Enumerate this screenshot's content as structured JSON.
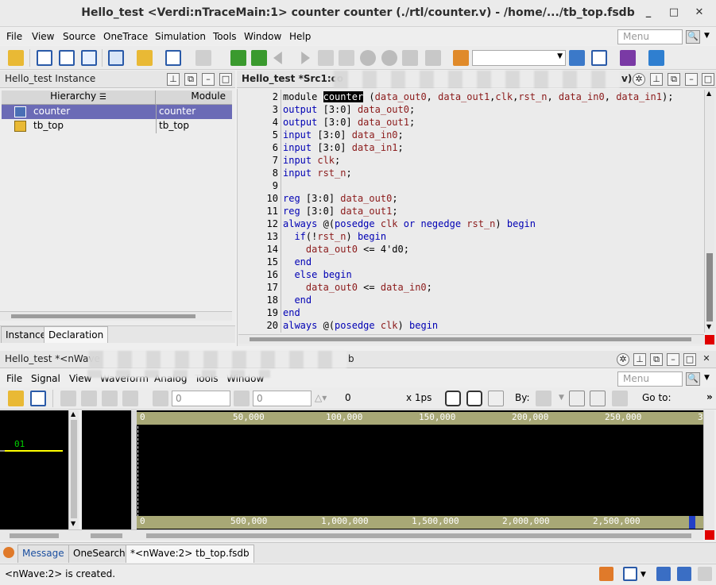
{
  "window": {
    "title": "Hello_test <Verdi:nTraceMain:1> counter counter (./rtl/counter.v) - /home/.../tb_top.fsdb"
  },
  "main_menu": {
    "items": [
      "File",
      "View",
      "Source",
      "OneTrace",
      "Simulation",
      "Tools",
      "Window",
      "Help"
    ],
    "search_placeholder": "Menu"
  },
  "instance_panel": {
    "title": "Hello_test Instance",
    "columns": [
      "Hierarchy",
      "Module"
    ],
    "rows": [
      {
        "hierarchy": "counter",
        "module": "counter"
      },
      {
        "hierarchy": "tb_top",
        "module": "tb_top"
      }
    ],
    "tabs": [
      "Instance",
      "Declaration"
    ]
  },
  "source_panel": {
    "title": "Hello_test *Src1:co",
    "title_tail": "v)",
    "lines": [
      {
        "n": "2",
        "text": "module counter (data_out0, data_out1,clk,rst_n, data_in0, data_in1);"
      },
      {
        "n": "3",
        "text": "output [3:0] data_out0;"
      },
      {
        "n": "4",
        "text": "output [3:0] data_out1;"
      },
      {
        "n": "5",
        "text": "input [3:0] data_in0;"
      },
      {
        "n": "6",
        "text": "input [3:0] data_in1;"
      },
      {
        "n": "7",
        "text": "input clk;"
      },
      {
        "n": "8",
        "text": "input rst_n;"
      },
      {
        "n": "9",
        "text": ""
      },
      {
        "n": "10",
        "text": "reg [3:0] data_out0;"
      },
      {
        "n": "11",
        "text": "reg [3:0] data_out1;"
      },
      {
        "n": "12",
        "text": "always @(posedge clk or negedge rst_n) begin"
      },
      {
        "n": "13",
        "text": "  if(!rst_n) begin"
      },
      {
        "n": "14",
        "text": "    data_out0 <= 4'd0;"
      },
      {
        "n": "15",
        "text": "  end"
      },
      {
        "n": "16",
        "text": "  else begin"
      },
      {
        "n": "17",
        "text": "    data_out0 <= data_in0;"
      },
      {
        "n": "18",
        "text": "  end"
      },
      {
        "n": "19",
        "text": "end"
      },
      {
        "n": "20",
        "text": "always @(posedge clk) begin"
      }
    ]
  },
  "nwave_panel": {
    "title": "Hello_test *<nWave",
    "title_tail": "b",
    "menu": [
      "File",
      "Signal",
      "View",
      "Waveform",
      "Analog",
      "Tools",
      "Window"
    ],
    "search_placeholder": "Menu",
    "cursor_time": "0",
    "marker_time": "0",
    "delta": "0",
    "time_unit": "x 1ps",
    "by_label": "By:",
    "goto_label": "Go to:",
    "signal_value": "01",
    "top_ruler": [
      "0",
      "50,000",
      "100,000",
      "150,000",
      "200,000",
      "250,000",
      "3"
    ],
    "bottom_ruler": [
      "0",
      "500,000",
      "1,000,000",
      "1,500,000",
      "2,000,000",
      "2,500,000"
    ]
  },
  "bottom_tabs": [
    "Message",
    "OneSearch",
    "*<nWave:2> tb_top.fsdb"
  ],
  "status": "<nWave:2> is created.",
  "colors": {
    "accent_select": "#6b6bb6",
    "keyword": "#0000b4",
    "identifier": "#8b1a1a",
    "wave": "#ffff00",
    "ruler": "#a8a876"
  }
}
